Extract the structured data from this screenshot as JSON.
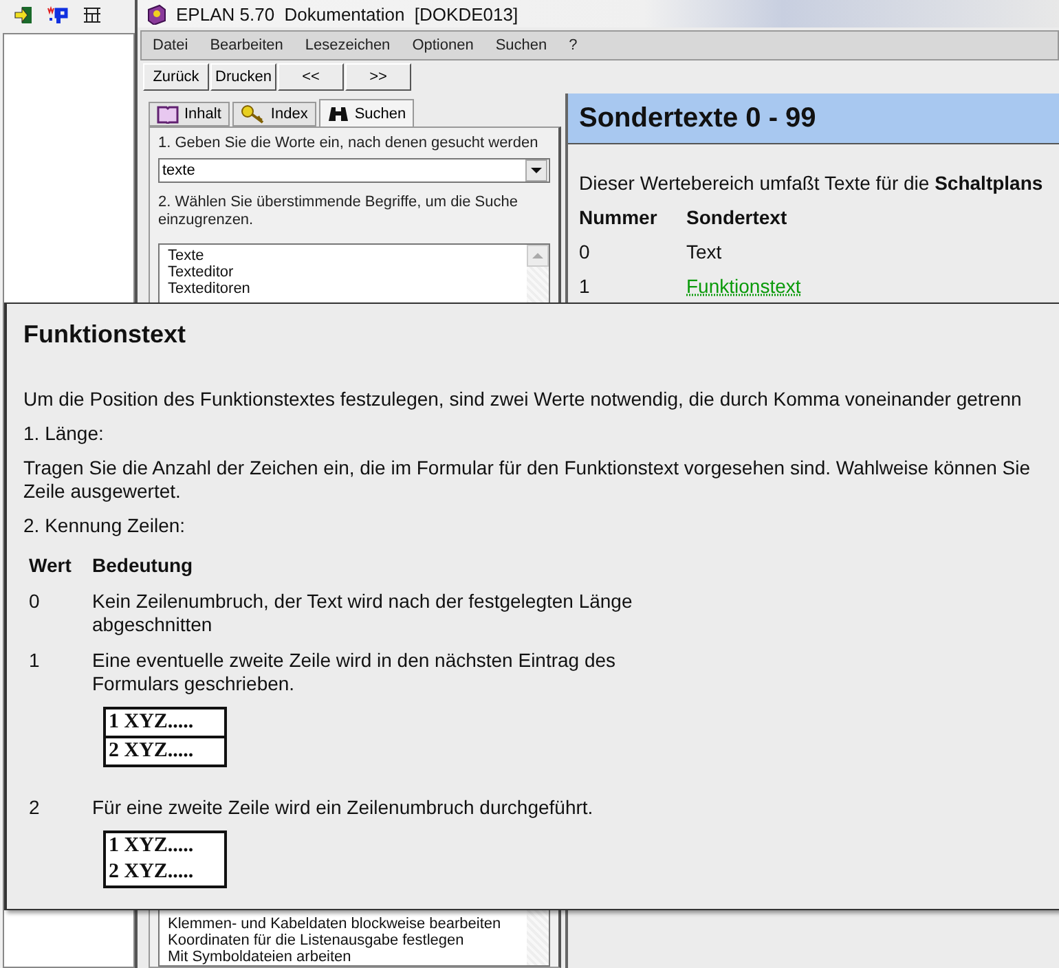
{
  "window": {
    "title": "EPLAN 5.70  Dokumentation  [DOKDE013]"
  },
  "menu": [
    {
      "label": "Datei"
    },
    {
      "label": "Bearbeiten"
    },
    {
      "label": "Lesezeichen"
    },
    {
      "label": "Optionen"
    },
    {
      "label": "Suchen"
    },
    {
      "label": "?"
    }
  ],
  "buttons": [
    {
      "label": "Zurück"
    },
    {
      "label": "Drucken"
    },
    {
      "label": "<<"
    },
    {
      "label": ">>"
    }
  ],
  "tabs": [
    {
      "label": "Inhalt",
      "kind": "book",
      "selected": false
    },
    {
      "label": "Index",
      "kind": "key",
      "selected": false
    },
    {
      "label": "Suchen",
      "kind": "binoculars",
      "selected": true
    }
  ],
  "search": {
    "step1": "1. Geben Sie die Worte ein, nach denen gesucht werden",
    "value": "texte",
    "step2": "2. Wählen Sie überstimmende Begriffe, um die Suche einzugrenzen.",
    "top_items": [
      "Texte",
      "Texteditor",
      "Texteditoren"
    ],
    "bottom_items": [
      "Klemmen- und Kabeldaten blockweise bearbeiten",
      "Koordinaten für die Listenausgabe festlegen",
      "Mit Symboldateien arbeiten"
    ]
  },
  "topic": {
    "title": "Sondertexte 0 - 99",
    "intro": "Dieser Wertebereich umfaßt Texte für die **Schaltplans**",
    "columns": [
      "Nummer",
      "Sondertext"
    ],
    "rows": [
      {
        "number": "0",
        "text": "Text",
        "kind": "plain"
      },
      {
        "number": "1",
        "text": "Funktionstext",
        "kind": "link"
      }
    ]
  },
  "popup": {
    "title": "Funktionstext",
    "blocks": [
      {
        "kind": "text",
        "lines": [
          "Um die Position des Funktionstextes festzulegen, sind zwei Werte notwendig, die durch Komma voneinander getrenn"
        ]
      },
      {
        "kind": "text",
        "lines": [
          "1. Länge:"
        ]
      },
      {
        "kind": "text",
        "lines": [
          "Tragen Sie die Anzahl der Zeichen ein, die im Formular für den Funktionstext vorgesehen sind. Wahlweise können Sie",
          "Zeile ausgewertet."
        ]
      },
      {
        "kind": "text",
        "lines": [
          "2. Kennung Zeilen:"
        ]
      }
    ],
    "columns": [
      "Wert",
      "Bedeutung"
    ],
    "rows": [
      {
        "value": "0",
        "meaning": "Kein Zeilenumbruch, der Text wird nach der festgelegten Länge abgeschnitten"
      },
      {
        "value": "1",
        "meaning": "Eine eventuelle zweite Zeile wird in den nächsten Eintrag des Formulars geschrieben.",
        "example": {
          "divided": true,
          "lines": [
            "1 XYZ.....",
            "2 XYZ....."
          ]
        }
      },
      {
        "value": "2",
        "meaning": "Für eine zweite Zeile wird ein Zeilenumbruch durchgeführt.",
        "example": {
          "divided": false,
          "lines": [
            "1 XYZ.....",
            "2 XYZ....."
          ]
        }
      }
    ]
  }
}
